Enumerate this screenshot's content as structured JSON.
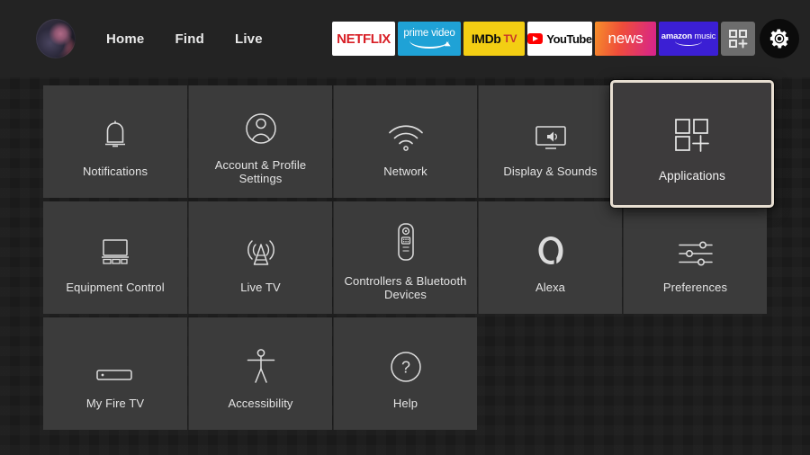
{
  "topnav": {
    "avatar": {
      "name": "user-avatar"
    },
    "links": [
      {
        "label": "Home"
      },
      {
        "label": "Find"
      },
      {
        "label": "Live"
      }
    ],
    "apps": [
      {
        "name": "netflix",
        "label": "NETFLIX",
        "bg": "#ffffff",
        "fg": "#d81f26"
      },
      {
        "name": "prime-video",
        "label": "prime video",
        "bg": "#1fa2d6",
        "fg": "#ffffff"
      },
      {
        "name": "imdb-tv",
        "label": "IMDb",
        "label2": "TV",
        "bg": "#f3ce13",
        "fg": "#0d0d0d",
        "fg2": "#c8342a"
      },
      {
        "name": "youtube",
        "label": "YouTube",
        "bg": "#ffffff",
        "fg": "#0d0d0d",
        "accent": "#ff0000"
      },
      {
        "name": "news",
        "label": "news",
        "bg": "#ef4d3a",
        "fg": "#ffffff"
      },
      {
        "name": "amazon-music",
        "label": "amazon",
        "label2": "music",
        "bg": "#3b1fd4",
        "fg": "#ffffff"
      }
    ],
    "apps_grid_button": {
      "name": "apps-grid-icon",
      "label": "Apps"
    },
    "settings_button": {
      "name": "gear-icon",
      "label": "Settings"
    }
  },
  "settings_grid": {
    "focused_item": "Applications",
    "tiles": [
      {
        "label": "Notifications",
        "icon": "bell-icon"
      },
      {
        "label": "Account & Profile Settings",
        "icon": "user-circle-icon"
      },
      {
        "label": "Network",
        "icon": "wifi-icon"
      },
      {
        "label": "Display & Sounds",
        "icon": "display-sound-icon"
      },
      {
        "label": "Applications",
        "icon": "apps-grid-plus-icon"
      },
      {
        "label": "Equipment Control",
        "icon": "tv-equipment-icon"
      },
      {
        "label": "Live TV",
        "icon": "broadcast-tower-icon"
      },
      {
        "label": "Controllers & Bluetooth Devices",
        "icon": "remote-control-icon"
      },
      {
        "label": "Alexa",
        "icon": "alexa-ring-icon"
      },
      {
        "label": "Preferences",
        "icon": "sliders-icon"
      },
      {
        "label": "My Fire TV",
        "icon": "fire-tv-stick-icon"
      },
      {
        "label": "Accessibility",
        "icon": "accessibility-person-icon"
      },
      {
        "label": "Help",
        "icon": "question-circle-icon"
      }
    ]
  },
  "colors": {
    "page_background": "#1a1a1a",
    "topbar_background": "#232323",
    "tile_background": "#3b3b3b",
    "tile_text": "#e4e4e4",
    "focus_border": "#e8dfd2"
  }
}
